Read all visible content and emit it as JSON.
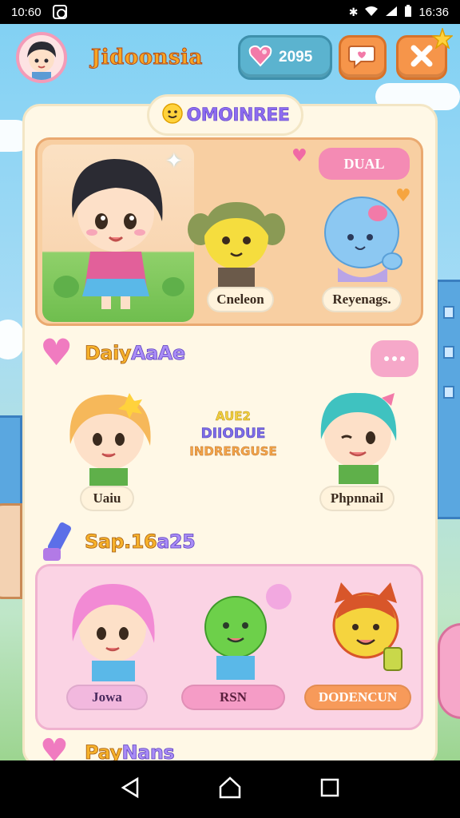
{
  "status_bar": {
    "time_left": "10:60",
    "time_right": "16:36",
    "icons": [
      "app-icon",
      "bluetooth-icon",
      "wifi-icon",
      "signal-icon",
      "battery-icon"
    ]
  },
  "header": {
    "title": "Jidoonsia",
    "currency_value": "2095",
    "icons": [
      "avatar",
      "heart-gem-icon",
      "chat-icon",
      "close-icon",
      "star-icon"
    ]
  },
  "panel": {
    "tab_label": "OMOINREE"
  },
  "card1": {
    "bubble": "DUAL",
    "characters": [
      {
        "label": ""
      },
      {
        "label": "Cneleon"
      },
      {
        "label": "Reyenags."
      }
    ]
  },
  "section2": {
    "title_part1": "Daiy",
    "title_part2": "AaAe",
    "characters": [
      {
        "label": "Uaiu"
      },
      {
        "label": "Phpnnail"
      }
    ],
    "center": {
      "line1": "AUE2",
      "line2": "DIIODUE",
      "line3": "INDRERGUSE"
    }
  },
  "section3": {
    "title_part1": "Sap.16",
    "title_part2": "a25",
    "characters": [
      {
        "label": "Jowa"
      },
      {
        "label": "RSN"
      },
      {
        "label": "DODENCUN"
      }
    ]
  },
  "section4": {
    "title_part1": "Pay",
    "title_part2": "Nans"
  },
  "colors": {
    "accent_orange": "#f6954a",
    "accent_blue": "#5bb3cf",
    "panel_bg": "#fff8e6",
    "card_peach": "#f8cfa2",
    "card_pink": "#fbd3e4"
  },
  "nav": [
    "back-icon",
    "home-icon",
    "recents-icon"
  ]
}
